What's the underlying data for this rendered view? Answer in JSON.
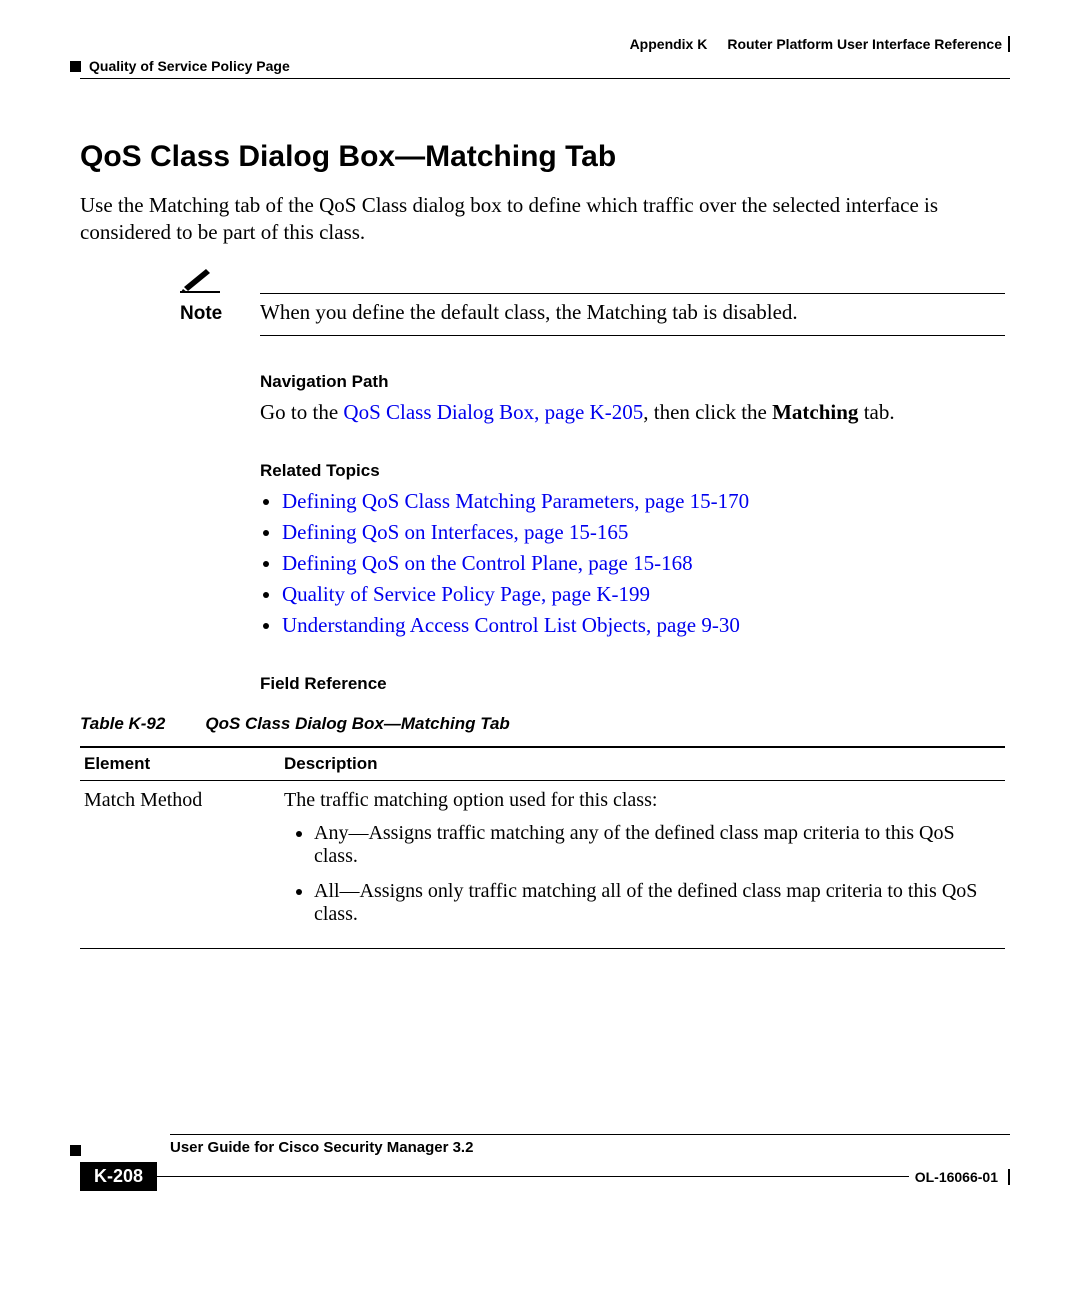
{
  "header": {
    "appendix": "Appendix K",
    "appendix_title": "Router Platform User Interface Reference",
    "section_breadcrumb": "Quality of Service Policy Page"
  },
  "title": "QoS Class Dialog Box—Matching Tab",
  "intro": "Use the Matching tab of the QoS Class dialog box to define which traffic over the selected interface is considered to be part of this class.",
  "note": {
    "label": "Note",
    "text": "When you define the default class, the Matching tab is disabled."
  },
  "nav": {
    "heading": "Navigation Path",
    "prefix": "Go to the ",
    "link": "QoS Class Dialog Box, page K-205",
    "middle": ", then click the ",
    "bold": "Matching",
    "suffix": " tab."
  },
  "related": {
    "heading": "Related Topics",
    "items": [
      "Defining QoS Class Matching Parameters, page 15-170",
      "Defining QoS on Interfaces, page 15-165",
      "Defining QoS on the Control Plane, page 15-168",
      "Quality of Service Policy Page, page K-199",
      "Understanding Access Control List Objects, page 9-30"
    ]
  },
  "fieldref": {
    "heading": "Field Reference",
    "table_number": "Table K-92",
    "table_title": "QoS Class Dialog Box—Matching Tab",
    "columns": {
      "element": "Element",
      "description": "Description"
    },
    "rows": [
      {
        "element": "Match Method",
        "desc_lead": "The traffic matching option used for this class:",
        "bullets": [
          "Any—Assigns traffic matching any of the defined class map criteria to this QoS class.",
          "All—Assigns only traffic matching all of the defined class map criteria to this QoS class."
        ]
      }
    ]
  },
  "footer": {
    "guide": "User Guide for Cisco Security Manager 3.2",
    "page": "K-208",
    "docnum": "OL-16066-01"
  }
}
